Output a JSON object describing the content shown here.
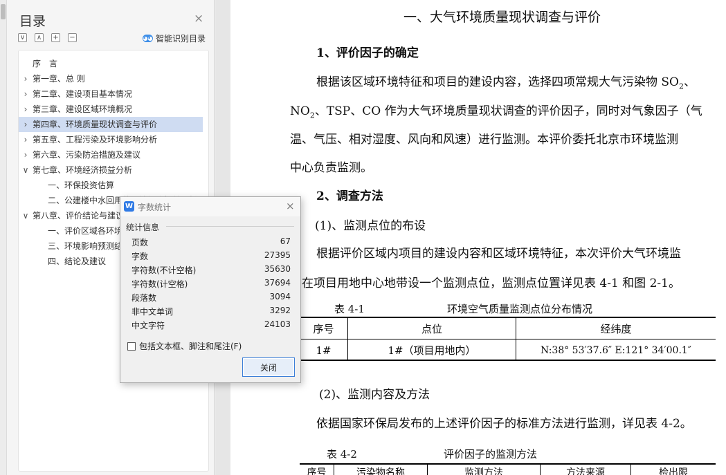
{
  "toc": {
    "title": "目录",
    "close": "×",
    "tools": [
      "∨",
      "∧",
      "+",
      "−"
    ],
    "smart_label": "智能识别目录",
    "items": [
      {
        "label": "序　言",
        "arrow": "",
        "indent": 1
      },
      {
        "label": "第一章、总  则",
        "arrow": "›",
        "indent": 1
      },
      {
        "label": "第二章、建设项目基本情况",
        "arrow": "›",
        "indent": 1
      },
      {
        "label": "第三章、建设区域环境概况",
        "arrow": "›",
        "indent": 1
      },
      {
        "label": "第四章、环境质量现状调查与评价",
        "arrow": "›",
        "indent": 1,
        "selected": true
      },
      {
        "label": "第五章、工程污染及环境影响分析",
        "arrow": "›",
        "indent": 1
      },
      {
        "label": "第六章、污染防治措施及建议",
        "arrow": "›",
        "indent": 1
      },
      {
        "label": "第七章、环境经济损益分析",
        "arrow": "∨",
        "indent": 1
      },
      {
        "label": "一、环保投资估算",
        "arrow": "",
        "indent": 2
      },
      {
        "label": "二、公建楼中水回用的环境经济损益分析",
        "arrow": "",
        "indent": 2
      },
      {
        "label": "第八章、评价结论与建议",
        "arrow": "∨",
        "indent": 1
      },
      {
        "label": "一、评价区域各环境要素现状评价结论",
        "arrow": "",
        "indent": 2
      },
      {
        "label": "三、环境影响预测结论",
        "arrow": "",
        "indent": 2
      },
      {
        "label": "四、结论及建议",
        "arrow": "",
        "indent": 2
      }
    ]
  },
  "doc": {
    "heading": "一、大气环境质量现状调查与评价",
    "s1_title": "1、评价因子的确定",
    "p1_l1a": "根据该区域环境特征和项目的建设内容，选择四项常规大气污染物 SO",
    "p1_l1_sub": "2",
    "p1_l1b": "、",
    "p1_l2a": "NO",
    "p1_l2_sub": "2",
    "p1_l2b": "、TSP、CO 作为大气环境质量现状调查的评价因子，同时对气象因子（气",
    "p1_l3": "温、气压、相对湿度、风向和风速）进行监测。本评价委托北京市环境监测",
    "p1_l4": "中心负责监测。",
    "s2_title": "2、调查方法",
    "s2_sub1": "(1)、监测点位的布设",
    "p2_l1": "根据评价区域内项目的建设内容和区域环境特征，本次评价大气环境监",
    "p2_l2": "测在项目用地中心地带设一个监测点位，监测点位置详见表 4-1 和图 2-1。",
    "t41_caption_num": "表 4-1",
    "t41_caption_title": "环境空气质量监测点位分布情况",
    "t41_headers": [
      "序号",
      "点位",
      "经纬度"
    ],
    "t41_row": [
      "1#",
      "1#（项目用地内）",
      "N:38° 53′37.6″   E:121° 34′00.1″"
    ],
    "s2_sub2": "(2)、监测内容及方法",
    "p3": "依据国家环保局发布的上述评价因子的标准方法进行监测，详见表 4-2。",
    "t42_caption_num": "表 4-2",
    "t42_caption_title": "评价因子的监测方法",
    "t42_headers": [
      "序号",
      "污染物名称",
      "监测方法",
      "方法来源",
      "检出限"
    ]
  },
  "dialog": {
    "title": "字数统计",
    "close": "×",
    "group_label": "统计信息",
    "stats": [
      {
        "label": "页数",
        "value": "67"
      },
      {
        "label": "字数",
        "value": "27395"
      },
      {
        "label": "字符数(不计空格)",
        "value": "35630"
      },
      {
        "label": "字符数(计空格)",
        "value": "37694"
      },
      {
        "label": "段落数",
        "value": "3094"
      },
      {
        "label": "非中文单词",
        "value": "3292"
      },
      {
        "label": "中文字符",
        "value": "24103"
      }
    ],
    "checkbox_label": "包括文本框、脚注和尾注(F)",
    "checkbox_checked": false,
    "close_button": "关闭"
  }
}
